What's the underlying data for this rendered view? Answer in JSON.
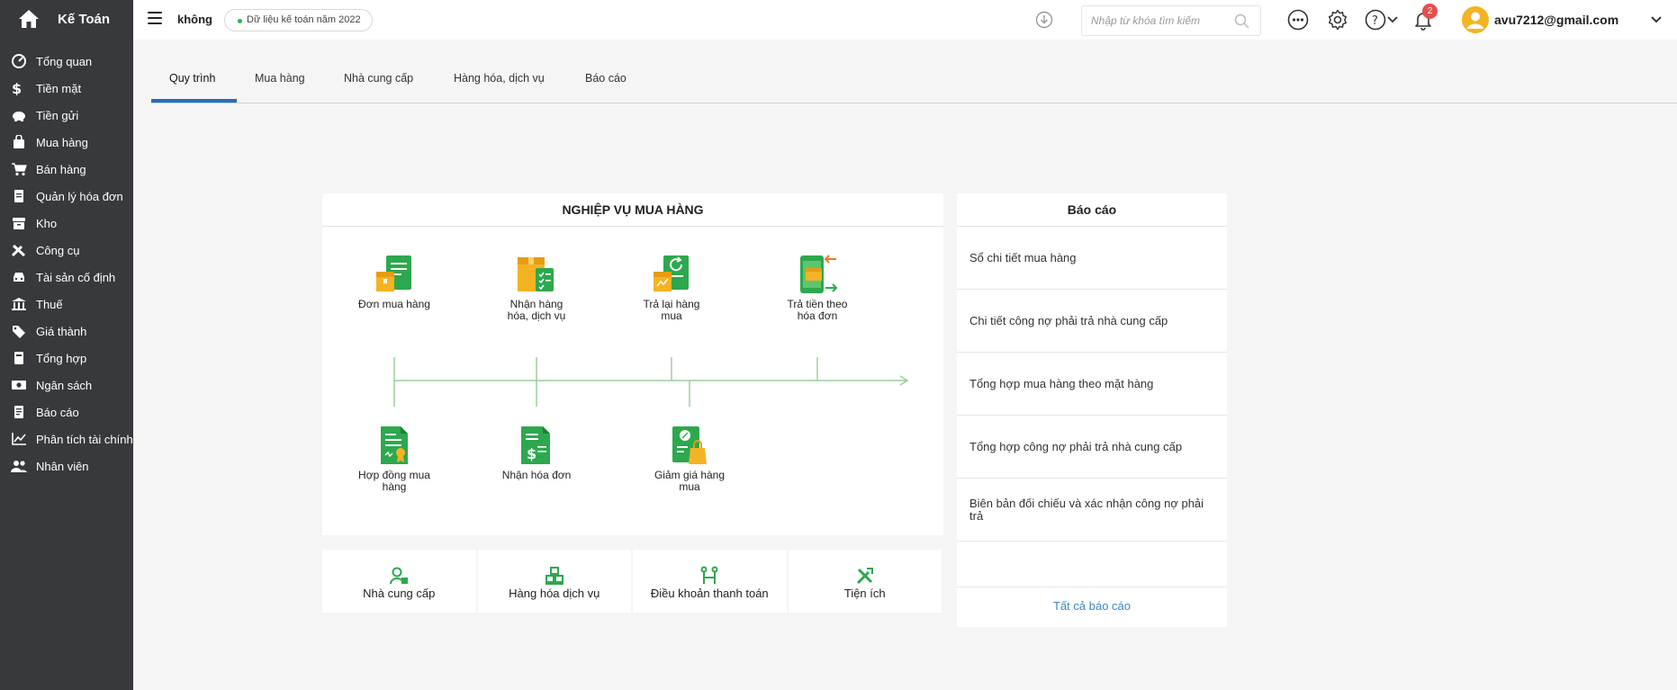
{
  "app": {
    "title": "Kế Toán"
  },
  "sidebar": {
    "items": [
      {
        "label": "Tổng quan",
        "icon": "dashboard-icon"
      },
      {
        "label": "Tiền mặt",
        "icon": "dollar-icon"
      },
      {
        "label": "Tiền gửi",
        "icon": "piggy-bank-icon"
      },
      {
        "label": "Mua hàng",
        "icon": "shopping-bag-icon"
      },
      {
        "label": "Bán hàng",
        "icon": "cart-icon"
      },
      {
        "label": "Quản lý hóa đơn",
        "icon": "invoice-icon"
      },
      {
        "label": "Kho",
        "icon": "warehouse-icon"
      },
      {
        "label": "Công cụ",
        "icon": "tools-icon"
      },
      {
        "label": "Tài sản cố định",
        "icon": "car-icon"
      },
      {
        "label": "Thuế",
        "icon": "bank-icon"
      },
      {
        "label": "Giá thành",
        "icon": "price-tag-icon"
      },
      {
        "label": "Tổng hợp",
        "icon": "book-icon"
      },
      {
        "label": "Ngân sách",
        "icon": "money-icon"
      },
      {
        "label": "Báo cáo",
        "icon": "report-icon"
      },
      {
        "label": "Phân tích tài chính",
        "icon": "chart-line-icon"
      },
      {
        "label": "Nhân viên",
        "icon": "users-icon"
      }
    ]
  },
  "header": {
    "company": "không",
    "data_year": "Dữ liệu kế toán năm 2022",
    "search_placeholder": "Nhập từ khóa tìm kiếm",
    "notification_count": "2",
    "user_email": "avu7212@gmail.com"
  },
  "tabs": [
    {
      "label": "Quy trình",
      "active": true
    },
    {
      "label": "Mua hàng"
    },
    {
      "label": "Nhà cung cấp"
    },
    {
      "label": "Hàng hóa, dịch vụ"
    },
    {
      "label": "Báo cáo"
    }
  ],
  "process": {
    "title": "NGHIỆP VỤ MUA HÀNG",
    "steps": [
      {
        "label": "Đơn mua hàng",
        "icon": "purchase-order-icon"
      },
      {
        "label": "Nhận hàng hóa, dịch vụ",
        "icon": "receive-goods-icon"
      },
      {
        "label": "Trả lại hàng mua",
        "icon": "return-goods-icon"
      },
      {
        "label": "Trả tiền theo hóa đơn",
        "icon": "pay-invoice-icon"
      },
      {
        "label": "Hợp đồng mua hàng",
        "icon": "purchase-contract-icon"
      },
      {
        "label": "Nhận hóa đơn",
        "icon": "receive-invoice-icon"
      },
      {
        "label": "Giảm giá hàng mua",
        "icon": "purchase-discount-icon"
      }
    ]
  },
  "shortcuts": [
    {
      "label": "Nhà cung cấp",
      "icon": "supplier-icon"
    },
    {
      "label": "Hàng hóa dịch vụ",
      "icon": "goods-icon"
    },
    {
      "label": "Điều khoản thanh toán",
      "icon": "payment-terms-icon"
    },
    {
      "label": "Tiện ích",
      "icon": "utilities-icon"
    }
  ],
  "reports": {
    "title": "Báo cáo",
    "items": [
      "Sổ chi tiết mua hàng",
      "Chi tiết công nợ phải trả nhà cung cấp",
      "Tổng hợp mua hàng theo mặt hàng",
      "Tổng hợp công nợ phải trả nhà cung cấp",
      "Biên bản đối chiếu và xác nhận công nợ phải trả"
    ],
    "all_label": "Tất cả báo cáo"
  },
  "colors": {
    "sidebar_bg": "#38393d",
    "accent_blue": "#1f6fbf",
    "link_blue": "#3a86c8",
    "icon_green": "#2da84e",
    "icon_orange": "#f4b323",
    "flow_line": "#9ccd9c",
    "badge_red": "#e84d4d"
  }
}
